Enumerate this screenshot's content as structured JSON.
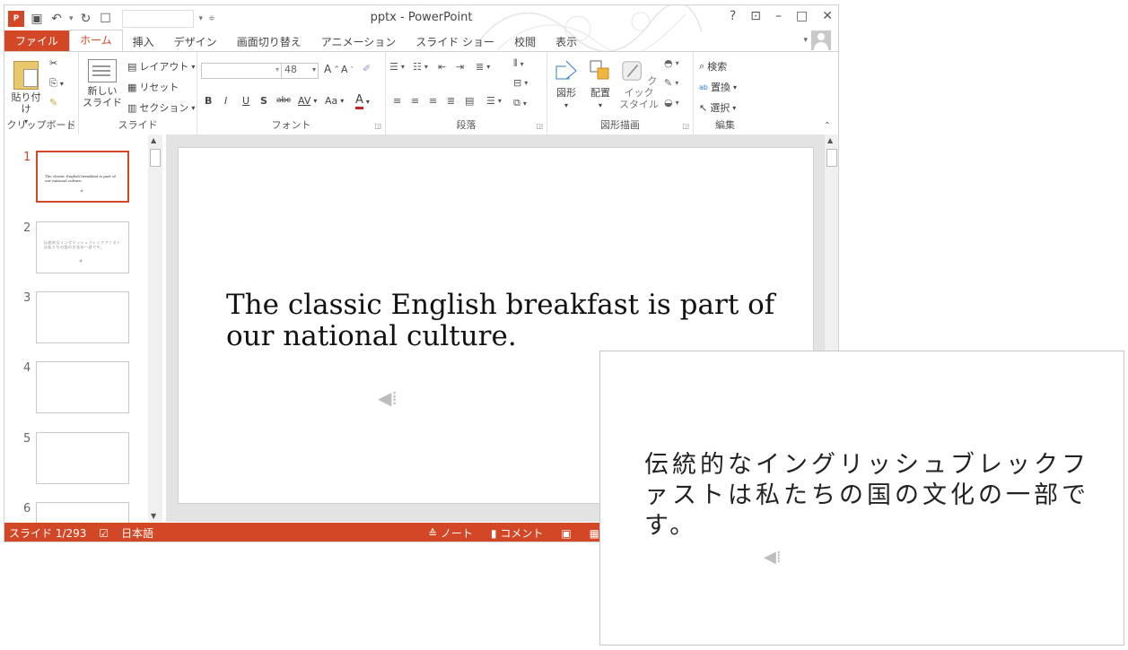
{
  "window": {
    "title": "pptx - PowerPoint",
    "app_logo": "P",
    "controls": [
      "?",
      "⊡",
      "–",
      "□",
      "✕"
    ]
  },
  "quick_access": {
    "save_icon": "save-icon",
    "undo_icon": "undo-icon",
    "redo_icon": "repeat-icon",
    "customize_icon": "touch-mode-icon"
  },
  "tabs": [
    {
      "label": "ファイル"
    },
    {
      "label": "ホーム"
    },
    {
      "label": "挿入"
    },
    {
      "label": "デザイン"
    },
    {
      "label": "画面切り替え"
    },
    {
      "label": "アニメーション"
    },
    {
      "label": "スライド ショー"
    },
    {
      "label": "校閲"
    },
    {
      "label": "表示"
    }
  ],
  "ribbon": {
    "clipboard": {
      "label": "クリップボード",
      "paste": "貼り付け"
    },
    "slides": {
      "label": "スライド",
      "new_slide_1": "新しい",
      "new_slide_2": "スライド",
      "layout": "レイアウト",
      "reset": "リセット",
      "section": "セクション"
    },
    "font": {
      "label": "フォント",
      "size": "48",
      "bold": "B",
      "italic": "I",
      "underline": "U",
      "shadow": "S",
      "strike": "abc",
      "spacing": "AV",
      "case": "Aa",
      "color": "A",
      "grow": "A",
      "shrink": "A"
    },
    "paragraph": {
      "label": "段落"
    },
    "drawing": {
      "label": "図形描画",
      "shapes": "図形",
      "arrange": "配置",
      "quick_styles_1": "クイック",
      "quick_styles_2": "スタイル"
    },
    "editing": {
      "label": "編集",
      "find": "検索",
      "replace": "置換",
      "select": "選択"
    }
  },
  "thumbnails": [
    {
      "num": "1",
      "text": "The classic English breakfast is part of our national culture.",
      "selected": true
    },
    {
      "num": "2",
      "text": "伝統的なイングリッシュブレックファストは私たちの国の文化の一部です。",
      "selected": false
    },
    {
      "num": "3",
      "text": "",
      "selected": false
    },
    {
      "num": "4",
      "text": "",
      "selected": false
    },
    {
      "num": "5",
      "text": "",
      "selected": false
    },
    {
      "num": "6",
      "text": "",
      "selected": false
    }
  ],
  "main_slide": {
    "text": "The classic English breakfast is part of our national culture.",
    "audio_icon": "speaker-icon"
  },
  "overlay_slide": {
    "text": "伝統的なイングリッシュブレックファストは私たちの国の文化の一部です。",
    "audio_icon": "speaker-icon"
  },
  "status": {
    "slide_count": "スライド 1/293",
    "language": "日本語",
    "notes": "ノート",
    "comments": "コメント"
  },
  "colors": {
    "accent": "#d24726",
    "ribbon_bg": "#ffffff",
    "edit_bg": "#e3e3e3"
  }
}
